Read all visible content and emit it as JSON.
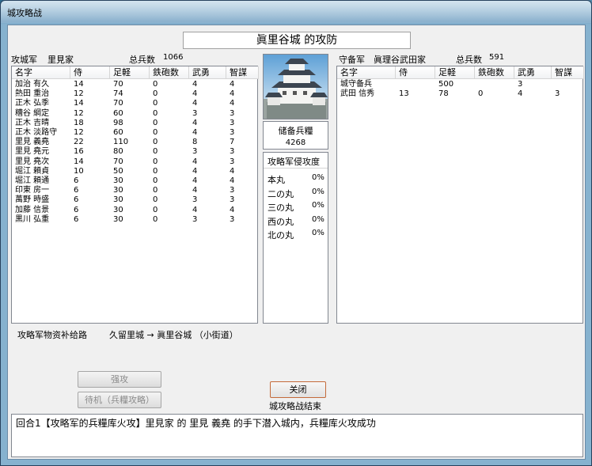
{
  "window": {
    "title": "城攻略战"
  },
  "castle_title": "眞里谷城 的攻防",
  "attacker": {
    "label": "攻城军",
    "clan": "里見家",
    "total_label": "总兵数",
    "total": "1066"
  },
  "defender": {
    "label": "守备军",
    "clan": "眞理谷武田家",
    "total_label": "总兵数",
    "total": "591"
  },
  "columns": [
    "名字",
    "侍",
    "足軽",
    "鉄砲数",
    "武勇",
    "智謀"
  ],
  "attacker_rows": [
    [
      "加治 有久",
      "14",
      "70",
      "0",
      "4",
      "4"
    ],
    [
      "熱田 重治",
      "12",
      "74",
      "0",
      "4",
      "4"
    ],
    [
      "正木 弘季",
      "14",
      "70",
      "0",
      "4",
      "4"
    ],
    [
      "糟谷 綱定",
      "12",
      "60",
      "0",
      "3",
      "3"
    ],
    [
      "正木 吉晴",
      "18",
      "98",
      "0",
      "4",
      "3"
    ],
    [
      "正木 淡路守",
      "12",
      "60",
      "0",
      "4",
      "3"
    ],
    [
      "里見 義堯",
      "22",
      "110",
      "0",
      "8",
      "7"
    ],
    [
      "里見 堯元",
      "16",
      "80",
      "0",
      "3",
      "3"
    ],
    [
      "里見 堯次",
      "14",
      "70",
      "0",
      "4",
      "3"
    ],
    [
      "堀江 頼貞",
      "10",
      "50",
      "0",
      "4",
      "4"
    ],
    [
      "堀江 頼通",
      "6",
      "30",
      "0",
      "4",
      "4"
    ],
    [
      "印東 房一",
      "6",
      "30",
      "0",
      "4",
      "3"
    ],
    [
      "萬野 時盛",
      "6",
      "30",
      "0",
      "3",
      "3"
    ],
    [
      "加藤 信景",
      "6",
      "30",
      "0",
      "4",
      "4"
    ],
    [
      "黒川 弘重",
      "6",
      "30",
      "0",
      "3",
      "3"
    ]
  ],
  "defender_rows": [
    [
      "城守备兵",
      "",
      "500",
      "",
      "3",
      ""
    ],
    [
      "武田 信秀",
      "13",
      "78",
      "0",
      "4",
      "3"
    ]
  ],
  "supply": {
    "label": "储备兵糧",
    "value": "4268"
  },
  "siege": {
    "label": "攻略军侵攻度",
    "items": [
      {
        "name": "本丸",
        "value": "0%"
      },
      {
        "name": "二の丸",
        "value": "0%"
      },
      {
        "name": "三の丸",
        "value": "0%"
      },
      {
        "name": "西の丸",
        "value": "0%"
      },
      {
        "name": "北の丸",
        "value": "0%"
      }
    ]
  },
  "route": {
    "label": "攻略军物资补给路",
    "text": "久留里城 → 眞里谷城 （小街道）"
  },
  "buttons": {
    "assault": "强攻",
    "wait": "待机（兵糧攻略）",
    "close": "关闭"
  },
  "status": "城攻略战结束",
  "log": "回合1【攻略军的兵糧库火攻】里見家 的 里見 義堯 的手下潜入城内，兵糧库火攻成功"
}
